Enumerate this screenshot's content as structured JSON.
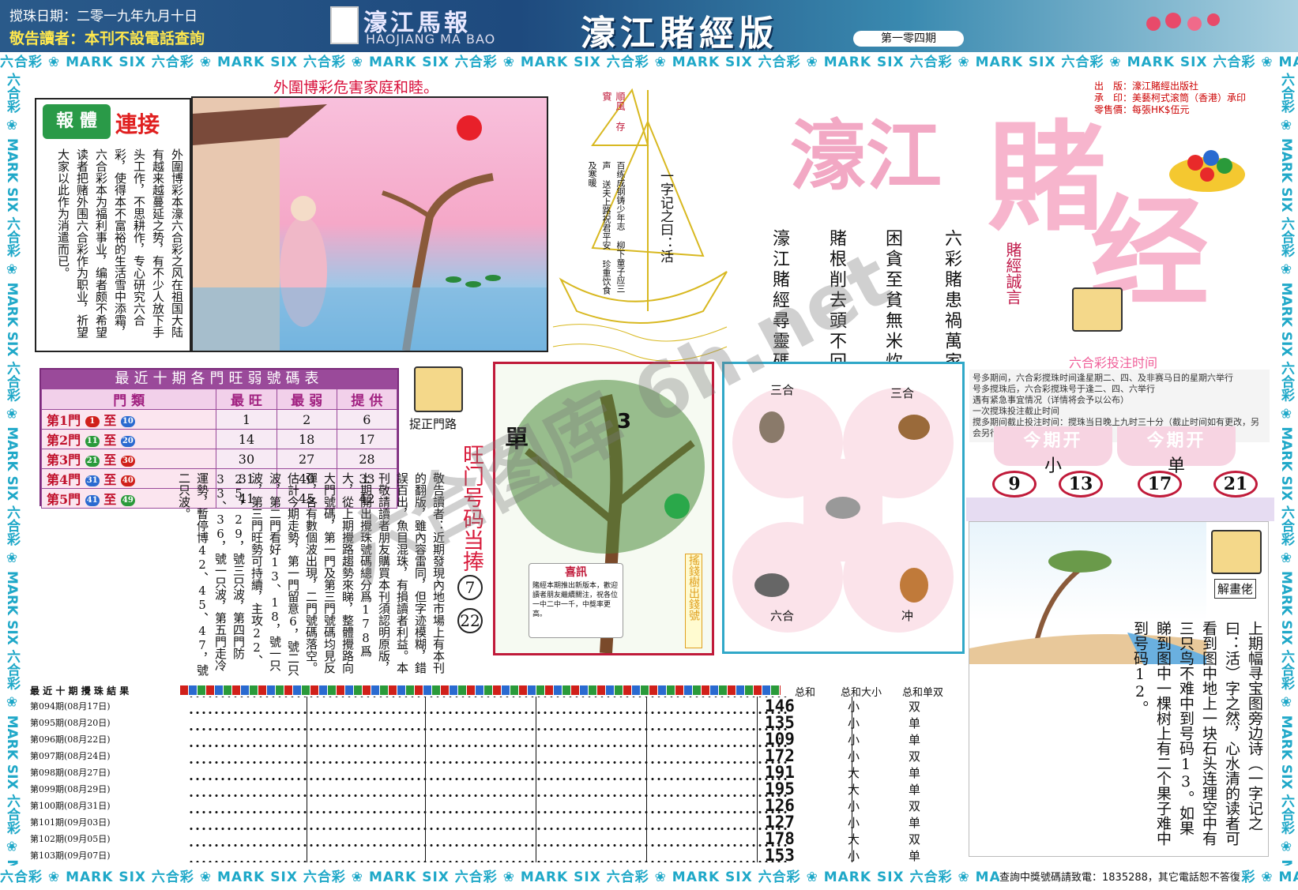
{
  "header": {
    "draw_date": "搅珠日期：二零一九年九月十日",
    "notice": "敬告讀者：本刊不設電話查詢",
    "paper_name": "濠江馬報",
    "paper_name_en": "HAOJIANG MA BAO",
    "edition": "濠江賭經版",
    "issue": "第一零四期"
  },
  "strip_text": "六合彩 ❀ MARK SIX 六合彩 ❀ MARK SIX 六合彩 ❀ MARK SIX 六合彩 ❀ MARK SIX 六合彩 ❀ MARK SIX 六合彩 ❀ MARK SIX 六合彩 ❀ MARK SIX 六合彩 ❀ MARK SIX 六合彩 ❀ MARK SIX 六合彩 ❀ MARK SIX 六合彩 ❀ MARK SIX",
  "warning_title": "外圍博彩危害家庭和睦。",
  "lianjie": {
    "tag1": "報 體",
    "tag2": "連接",
    "body": "外圍博彩本濠六合彩之风在祖国大陆有越来越蔓延之势，有不少人放下手头工作，不思耕作，专心研究六合彩，使得本不富裕的生活雪中添霜，六合彩本为福利事业，编者颇不希望读者把赌外围六合彩作为职业，祈望大家以此作为消遣而已。"
  },
  "boat": {
    "flag": "順風 存實",
    "poem": "百练成钢铸少年志 柳下童子应三声 送夫上路祝君平安 珍重饮食及寒暖",
    "saying": "一字记之曰：活"
  },
  "verses": {
    "v1": "六彩賭患禍萬家",
    "v2": "困貪至貧無米炊",
    "v3": "賭根削去頭不回",
    "v4": "濠江賭經尋靈碼",
    "red": "賭經誠言"
  },
  "publisher": {
    "line1": "出　版：濠江賭經出版社",
    "line2": "承　印：美藝柯式滚筒（香港）承印",
    "line3": "零售價：每張HK$伍元"
  },
  "title_art": {
    "a": "濠江",
    "b": "賭",
    "c": "经"
  },
  "table": {
    "title": "最近十期各門旺弱號碼表",
    "headers": [
      "門 類",
      "最 旺",
      "最 弱",
      "提 供"
    ],
    "rows": [
      {
        "gate": "第1門",
        "from": "1",
        "to": "10",
        "max": "1",
        "min": "2",
        "give": "6",
        "c1": "#d0201a",
        "c2": "#2a6ad0"
      },
      {
        "gate": "第2門",
        "from": "11",
        "to": "20",
        "max": "14",
        "min": "18",
        "give": "17",
        "c1": "#2a9a3a",
        "c2": "#2a6ad0"
      },
      {
        "gate": "第3門",
        "from": "21",
        "to": "30",
        "max": "30",
        "min": "27",
        "give": "28",
        "c1": "#2a9a3a",
        "c2": "#d0201a"
      },
      {
        "gate": "第4門",
        "from": "31",
        "to": "40",
        "max": "31",
        "min": "40",
        "give": "33",
        "c1": "#2a6ad0",
        "c2": "#d0201a"
      },
      {
        "gate": "第5門",
        "from": "41",
        "to": "49",
        "max": "41",
        "min": "45",
        "give": "42",
        "c1": "#2a6ad0",
        "c2": "#2a9a3a"
      }
    ]
  },
  "zhuozheng": {
    "label": "捉正門路"
  },
  "wangmen": {
    "label": "旺门号码当捧",
    "n1": "7",
    "n2": "22"
  },
  "notice_column": "敬告讀者：近期發現內地市場上有本刊的翻版，雖內容雷同，但字迹模糊，錯誤百出，魚目混珠，有損讀者利益。本刊敬請讀者朋友購買本刊須認明原版，上期開出攪珠號碼總分爲178爲大，從上期攪路趨勢來睇，整體攪路向大門號碼，第一門及第三門號碼均見反彈，各有數個波出現，二門號碼落空。估計今期走勢，第一門留意6，號二只波，第二門看好13、18，號一只波，第三門旺勢可持續，主攻22、25，29，號三只波，第四門防33、36，號一只波，第五門走冷運勢，暫停博42、45、47，號二只波。",
  "tree": {
    "label": "單",
    "num": "3",
    "card_title": "喜訊",
    "card_text": "賭經本期推出新版本，歡迎讀者朋友繼續關注，祝各位一中二中一千，中獎率更高。",
    "side": "搖錢樹出錢號"
  },
  "animals": {
    "tl": "三合",
    "tr": "三合",
    "bl": "六合",
    "br": "冲"
  },
  "time": {
    "title": "六合彩投注时间",
    "items": [
      "号多期间，六合彩搅珠时间逢星期二、四、及非赛马日的星期六举行",
      "号多搅珠后，六合彩搅珠号于逢二、四、六举行",
      "遇有紧急事宜情况（详情将会予以公布）",
      "一次搅珠投注截止时间",
      "搅多期间截止投注时间：搅珠当日晚上九时三十分（截止时间如有更改，另会另行公布）"
    ],
    "box1_title": "今期开",
    "box1_value": "小",
    "box2_title": "今期开",
    "box2_value": "单",
    "nums": [
      "9",
      "13",
      "17",
      "21"
    ]
  },
  "jiehua": {
    "label": "解畫佬",
    "text": "上期幅寻宝图旁边诗（一字记之曰：活）字之然，心水清的读者可看到图中地上一块石头连理空中有三只鸟不难中到号码13。如果睇到图中一棵树上有二个果子难中到号码12。"
  },
  "results": {
    "title": "最 近 十 期 攪 珠 結 果",
    "col_sum": "总和",
    "col_size": "总和大小",
    "col_odd": "总和单双",
    "rows": [
      {
        "issue": "第094期",
        "date": "(08月17日)",
        "sum": "146",
        "size": "小",
        "odd": "双"
      },
      {
        "issue": "第095期",
        "date": "(08月20日)",
        "sum": "135",
        "size": "小",
        "odd": "单"
      },
      {
        "issue": "第096期",
        "date": "(08月22日)",
        "sum": "109",
        "size": "小",
        "odd": "单"
      },
      {
        "issue": "第097期",
        "date": "(08月24日)",
        "sum": "172",
        "size": "小",
        "odd": "双"
      },
      {
        "issue": "第098期",
        "date": "(08月27日)",
        "sum": "191",
        "size": "大",
        "odd": "单"
      },
      {
        "issue": "第099期",
        "date": "(08月29日)",
        "sum": "195",
        "size": "大",
        "odd": "单"
      },
      {
        "issue": "第100期",
        "date": "(08月31日)",
        "sum": "126",
        "size": "小",
        "odd": "双"
      },
      {
        "issue": "第101期",
        "date": "(09月03日)",
        "sum": "127",
        "size": "小",
        "odd": "单"
      },
      {
        "issue": "第102期",
        "date": "(09月05日)",
        "sum": "178",
        "size": "大",
        "odd": "双"
      },
      {
        "issue": "第103期",
        "date": "(09月07日)",
        "sum": "153",
        "size": "小",
        "odd": "单"
      }
    ]
  },
  "query": "查詢中獎號碼請致電：1835288，其它電話恕不答復",
  "watermark": "六合图库 6h.net"
}
